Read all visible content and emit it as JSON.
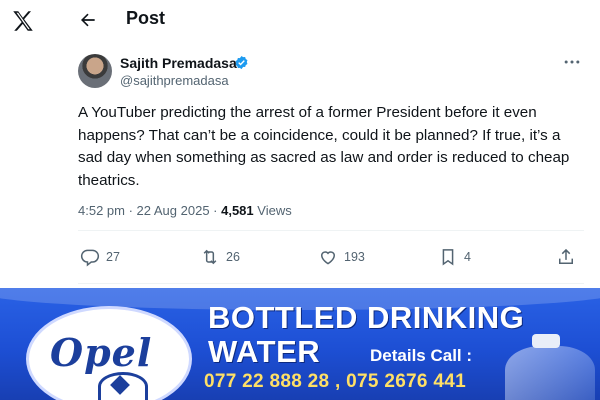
{
  "header": {
    "title": "Post"
  },
  "author": {
    "name": "Sajith Premadasa",
    "handle": "@sajithpremadasa"
  },
  "tweet": {
    "text": "A YouTuber predicting the arrest of a former President before it even happens? That can’t be a coincidence, could it be planned? If true, it’s a sad day when something as sacred as law and order is reduced to cheap theatrics.",
    "time": "4:52 pm · 22 Aug 2025 · ",
    "views_count": "4,581",
    "views_label": " Views"
  },
  "actions": {
    "replies": "27",
    "reposts": "26",
    "likes": "193",
    "bookmarks": "4"
  },
  "ad": {
    "brand": "Opel",
    "headline_line1": "BOTTLED DRINKING",
    "headline_line2": "WATER",
    "details": "Details Call :",
    "phones": "077 22 888 28 , 075 2676 441"
  },
  "icons": {
    "logo": "x-logo-icon",
    "back": "arrow-left-icon",
    "verified": "verified-badge-icon",
    "more": "more-horizontal-icon",
    "reply": "reply-icon",
    "repost": "repost-icon",
    "like": "heart-icon",
    "bookmark": "bookmark-icon",
    "share": "share-icon"
  },
  "colors": {
    "verified": "#1d9bf0",
    "text": "#0f1419",
    "secondary": "#536471",
    "banner": "#1d4fd4",
    "phones": "#ffe066"
  }
}
